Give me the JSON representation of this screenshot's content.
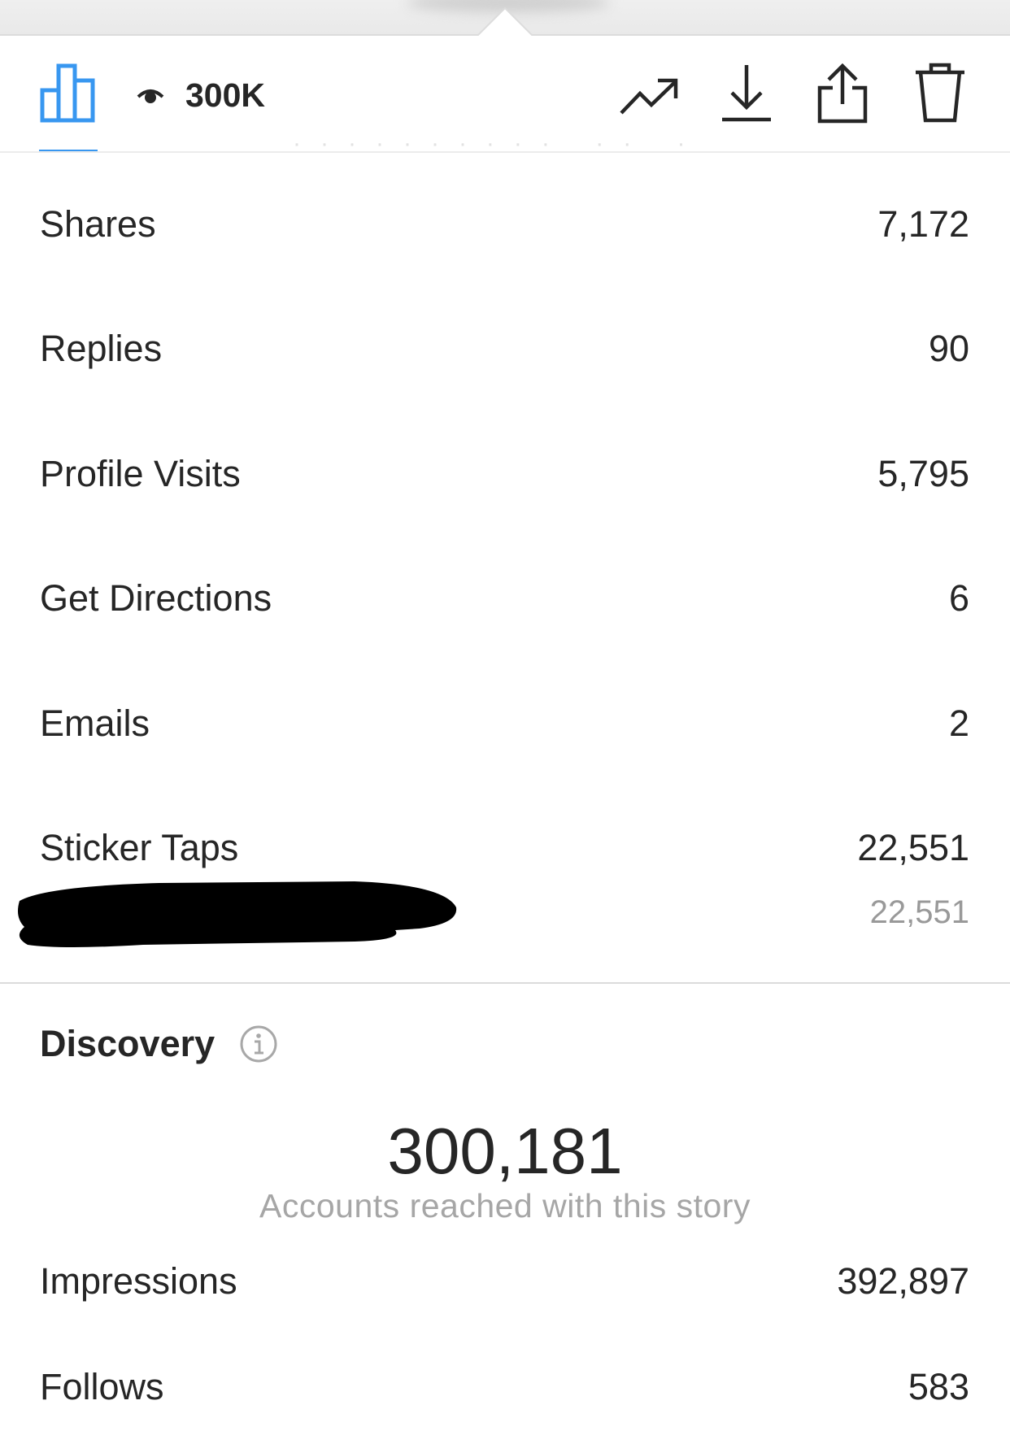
{
  "toolbar": {
    "views_count": "300K",
    "icons": [
      "bar-chart-icon",
      "eye-icon",
      "trend-icon",
      "download-icon",
      "share-icon",
      "trash-icon"
    ],
    "accent_color": "#3897f0"
  },
  "metrics": [
    {
      "label": "Shares",
      "value": "7,172"
    },
    {
      "label": "Replies",
      "value": "90"
    },
    {
      "label": "Profile Visits",
      "value": "5,795"
    },
    {
      "label": "Get Directions",
      "value": "6"
    },
    {
      "label": "Emails",
      "value": "2"
    },
    {
      "label": "Sticker Taps",
      "value": "22,551",
      "sub_value": "22,551"
    }
  ],
  "discovery": {
    "title": "Discovery",
    "reach_value": "300,181",
    "reach_caption": "Accounts reached with this story",
    "rows": [
      {
        "label": "Impressions",
        "value": "392,897"
      },
      {
        "label": "Follows",
        "value": "583"
      }
    ]
  }
}
